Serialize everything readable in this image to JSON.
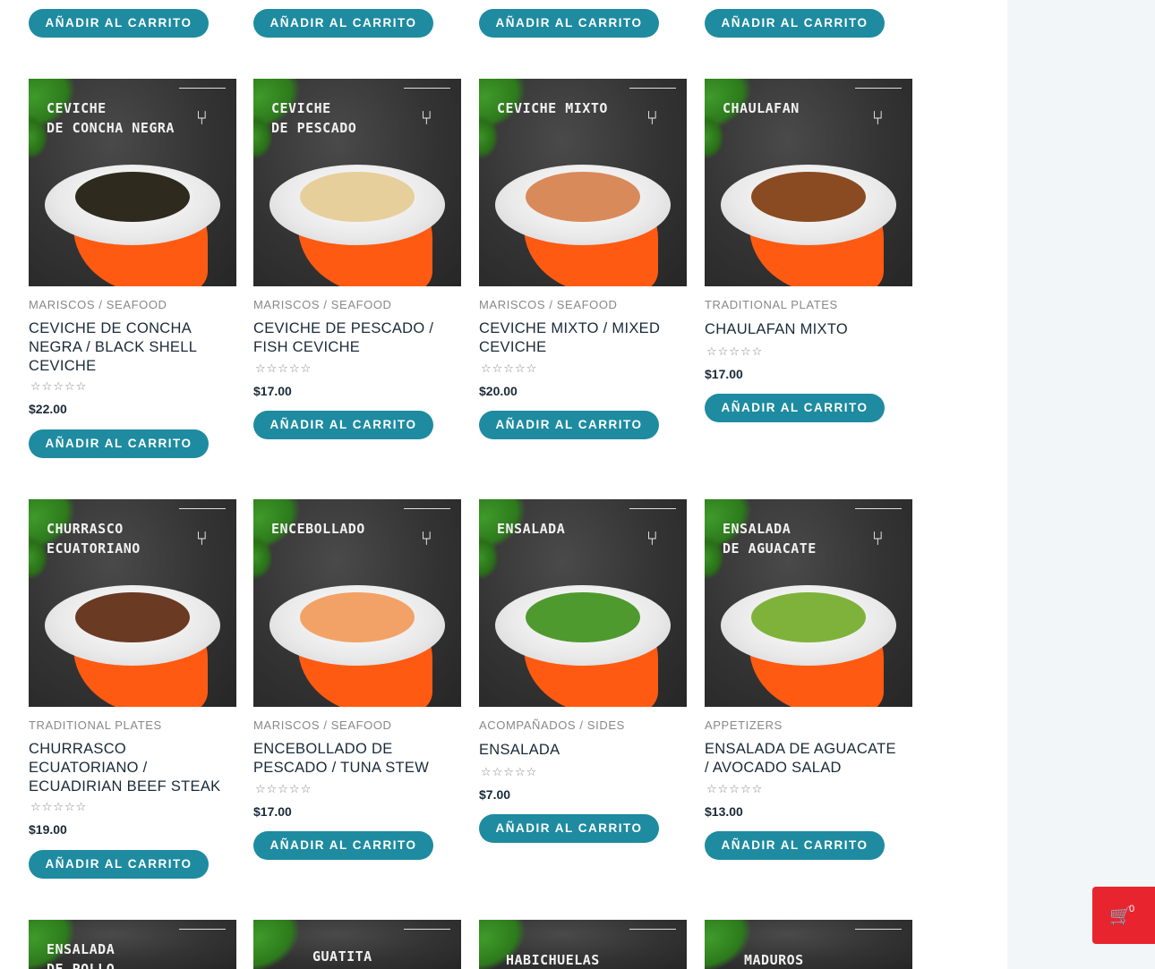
{
  "button_label": "Añadir al carrito",
  "rating_stars": "☆☆☆☆☆",
  "cart": {
    "count": "0",
    "icon": "cart-plus-icon",
    "color": "#e8252e"
  },
  "accent_color": "#1e8ba0",
  "top_row_buttons": [
    "Añadir al carrito",
    "Añadir al carrito",
    "Añadir al carrito",
    "Añadir al carrito"
  ],
  "products": [
    {
      "image_title": "CEVICHE\nDE CONCHA NEGRA",
      "category": "Mariscos / Seafood",
      "name": "Ceviche de Concha Negra / Black Shell Ceviche",
      "price": "$22.00",
      "button": "Añadir al carrito",
      "food_color": "#2e2a1e"
    },
    {
      "image_title": "CEVICHE\nDE PESCADO",
      "category": "Mariscos / Seafood",
      "name": "Ceviche de Pescado / Fish Ceviche",
      "price": "$17.00",
      "button": "Añadir al carrito",
      "food_color": "#e6cf9a"
    },
    {
      "image_title": "CEVICHE MIXTO",
      "category": "Mariscos / Seafood",
      "name": "Ceviche Mixto / Mixed Ceviche",
      "price": "$20.00",
      "button": "Añadir al carrito",
      "food_color": "#d98a5a"
    },
    {
      "image_title": "CHAULAFAN",
      "category": "Traditional Plates",
      "name": "Chaulafan Mixto",
      "price": "$17.00",
      "button": "Añadir al carrito",
      "food_color": "#8a4b22"
    },
    {
      "image_title": "CHURRASCO\nECUATORIANO",
      "category": "Traditional Plates",
      "name": "Churrasco Ecuatoriano / Ecuadirian Beef Steak",
      "price": "$19.00",
      "button": "Añadir al carrito",
      "food_color": "#6a3a22"
    },
    {
      "image_title": "ENCEBOLLADO",
      "category": "Mariscos / Seafood",
      "name": "Encebollado de Pescado / Tuna Stew",
      "price": "$17.00",
      "button": "Añadir al carrito",
      "food_color": "#f2a266"
    },
    {
      "image_title": "ENSALADA",
      "category": "Acompañados / Sides",
      "name": "Ensalada",
      "price": "$7.00",
      "button": "Añadir al carrito",
      "food_color": "#4f9a2e"
    },
    {
      "image_title": "ENSALADA\nDE AGUACATE",
      "category": "Appetizers",
      "name": "Ensalada de Aguacate / Avocado Salad",
      "price": "$13.00",
      "button": "Añadir al carrito",
      "food_color": "#7fb23a"
    }
  ],
  "bottom_row_titles": [
    "ENSALADA\nDE POLLO",
    "GUATITA",
    "HABICHUELAS",
    "MADUROS"
  ]
}
